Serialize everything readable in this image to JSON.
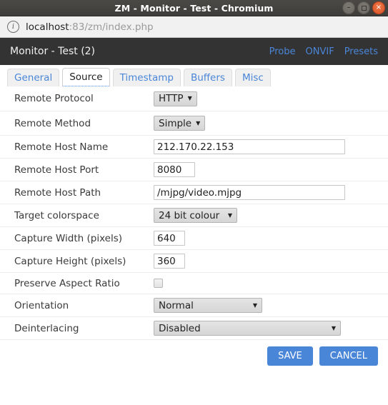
{
  "window": {
    "title": "ZM - Monitor - Test - Chromium",
    "controls": [
      {
        "name": "minimize",
        "glyph": "–"
      },
      {
        "name": "maximize",
        "glyph": ""
      },
      {
        "name": "close",
        "glyph": "×"
      }
    ]
  },
  "urlbar": {
    "info_icon": "i",
    "host": "localhost",
    "rest": ":83/zm/index.php"
  },
  "header": {
    "title": "Monitor - Test (2)",
    "links": [
      {
        "label": "Probe"
      },
      {
        "label": "ONVIF"
      },
      {
        "label": "Presets"
      }
    ],
    "background": "#333333",
    "link_color": "#4a86d8"
  },
  "tabs": [
    {
      "label": "General",
      "active": false
    },
    {
      "label": "Source",
      "active": true
    },
    {
      "label": "Timestamp",
      "active": false
    },
    {
      "label": "Buffers",
      "active": false
    },
    {
      "label": "Misc",
      "active": false
    }
  ],
  "form": {
    "rows": [
      {
        "label": "Remote Protocol",
        "type": "select",
        "value": "HTTP"
      },
      {
        "label": "Remote Method",
        "type": "select",
        "value": "Simple"
      },
      {
        "label": "Remote Host Name",
        "type": "text",
        "value": "212.170.22.153"
      },
      {
        "label": "Remote Host Port",
        "type": "text",
        "value": "8080"
      },
      {
        "label": "Remote Host Path",
        "type": "text",
        "value": "/mjpg/video.mjpg"
      },
      {
        "label": "Target colorspace",
        "type": "select",
        "value": "24 bit colour"
      },
      {
        "label": "Capture Width (pixels)",
        "type": "text",
        "value": "640"
      },
      {
        "label": "Capture Height (pixels)",
        "type": "text",
        "value": "360"
      },
      {
        "label": "Preserve Aspect Ratio",
        "type": "checkbox",
        "checked": false
      },
      {
        "label": "Orientation",
        "type": "select",
        "value": "Normal"
      },
      {
        "label": "Deinterlacing",
        "type": "select",
        "value": "Disabled"
      }
    ],
    "select_arrow": "▼"
  },
  "footer": {
    "save_label": "SAVE",
    "cancel_label": "CANCEL",
    "button_color": "#4a86d8"
  }
}
